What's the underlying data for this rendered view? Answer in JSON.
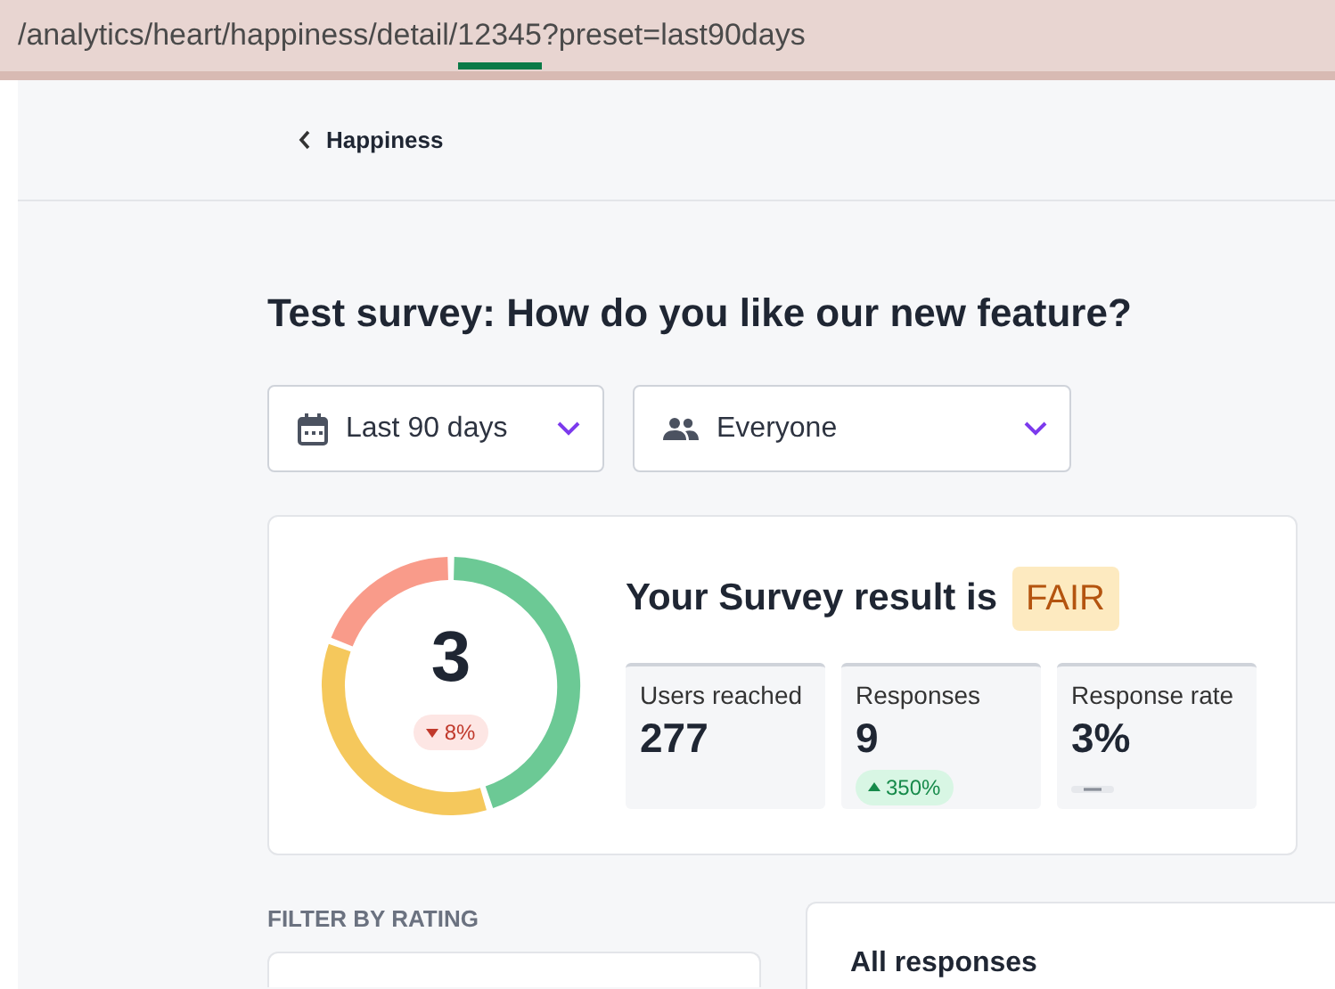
{
  "address_bar": {
    "prefix": "/analytics/heart/happiness/detail/",
    "highlighted": "12345",
    "suffix": "?preset=last90days"
  },
  "back_link": {
    "label": "Happiness"
  },
  "title": "Test survey: How do you like our new feature?",
  "filters": [
    {
      "kind": "date",
      "label": "Last 90 days"
    },
    {
      "kind": "audience",
      "label": "Everyone"
    }
  ],
  "summary": {
    "score": "3",
    "score_change": {
      "kind": "down",
      "text": "8%"
    },
    "heading": "Your Survey result is",
    "rating": "FAIR",
    "stats": [
      {
        "label": "Users reached",
        "value": "277"
      },
      {
        "label": "Responses",
        "value": "9",
        "change": {
          "kind": "up",
          "text": "350%"
        }
      },
      {
        "label": "Response rate",
        "value": "3%",
        "change": {
          "kind": "none"
        }
      }
    ]
  },
  "filter_by_rating": {
    "heading": "FILTER BY RATING"
  },
  "responses": {
    "heading": "All responses"
  }
}
